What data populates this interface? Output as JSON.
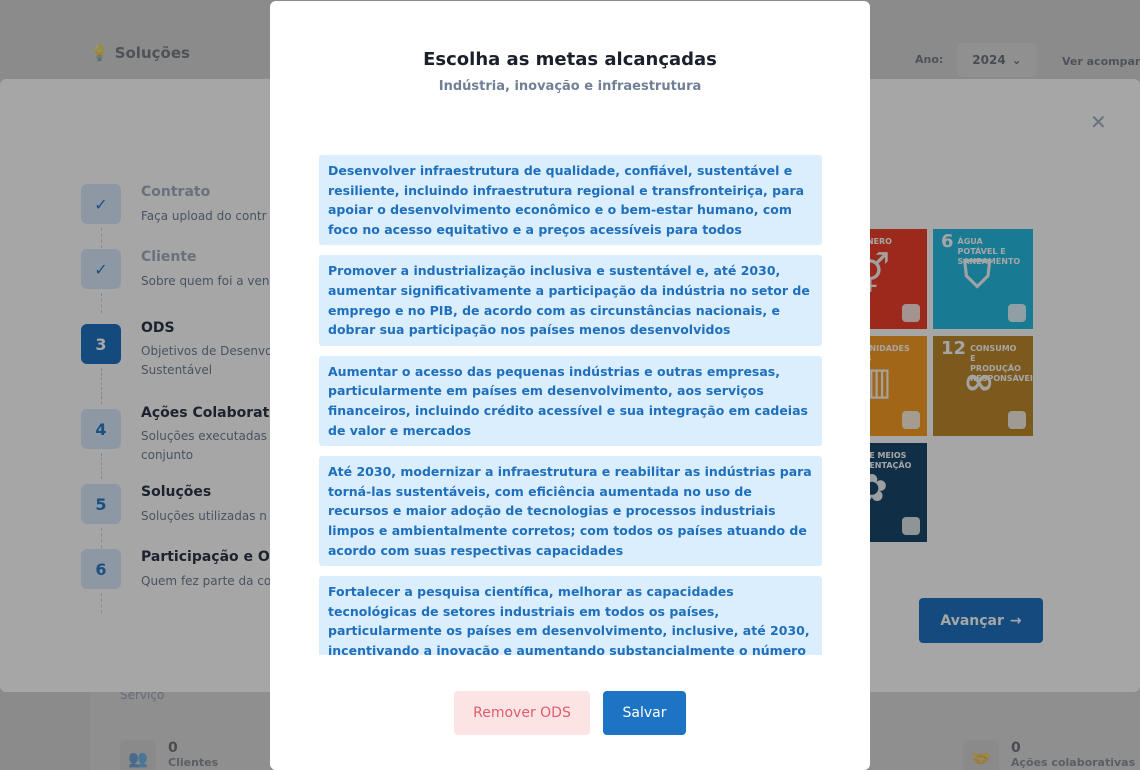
{
  "background": {
    "title": "Soluções",
    "year_label": "Ano:",
    "year_value": "2024",
    "ver_link": "Ver acompan",
    "servico_label": "Serviço",
    "stats": [
      {
        "value": "0",
        "label": "Clientes",
        "icon": "users-icon"
      },
      {
        "value": "0",
        "label": "Ações colaborativas",
        "icon": "handshake-icon"
      }
    ]
  },
  "wizard": {
    "steps": [
      {
        "badge": "✓",
        "title": "Contrato",
        "desc": "Faça upload do contr",
        "state": "done"
      },
      {
        "badge": "✓",
        "title": "Cliente",
        "desc": "Sobre quem foi a ven",
        "state": "done"
      },
      {
        "badge": "3",
        "title": "ODS",
        "desc": "Objetivos de Desenvo Sustentável",
        "state": "active"
      },
      {
        "badge": "4",
        "title": "Ações Colaborativ",
        "desc": "Soluções executadas conjunto",
        "state": "pending"
      },
      {
        "badge": "5",
        "title": "Soluções",
        "desc": "Soluções utilizadas n",
        "state": "pending"
      },
      {
        "badge": "6",
        "title": "Participação e Ori",
        "desc": "Quem fez parte da co",
        "state": "pending"
      }
    ],
    "ods_tiles": [
      {
        "num": "",
        "label": "LDADE NERO",
        "color": "#ef402c",
        "glyph": "⚥"
      },
      {
        "num": "6",
        "label": "ÁGUA POTÁVEL E SANEAMENTO",
        "color": "#27bde2",
        "glyph": "⛉"
      },
      {
        "num": "",
        "label": "DES E UNIDADES NTÁVEIS",
        "color": "#f99d26",
        "glyph": "▥"
      },
      {
        "num": "12",
        "label": "CONSUMO E PRODUÇÃO RESPONSÁVEIS",
        "color": "#bf8b2e",
        "glyph": "∞"
      },
      {
        "num": "",
        "label": "CERIAS E MEIOS IMPLEMENTAÇÃO",
        "color": "#19486a",
        "glyph": "✿"
      }
    ],
    "advance_label": "Avançar"
  },
  "dialog": {
    "title": "Escolha as metas alcançadas",
    "subtitle": "Indústria, inovação e infraestrutura",
    "goals": [
      "Desenvolver infraestrutura de qualidade, confiável, sustentável e resiliente, incluindo infraestrutura regional e transfronteiriça, para apoiar o desenvolvimento econômico e o bem-estar humano, com foco no acesso equitativo e a preços acessíveis para todos",
      "Promover a industrialização inclusiva e sustentável e, até 2030, aumentar significativamente a participação da indústria no setor de emprego e no PIB, de acordo com as circunstâncias nacionais, e dobrar sua participação nos países menos desenvolvidos",
      "Aumentar o acesso das pequenas indústrias e outras empresas, particularmente em países em desenvolvimento, aos serviços financeiros, incluindo crédito acessível e sua integração em cadeias de valor e mercados",
      "Até 2030, modernizar a infraestrutura e reabilitar as indústrias para torná-las sustentáveis, com eficiência aumentada no uso de recursos e maior adoção de tecnologias e processos industriais limpos e ambientalmente corretos; com todos os países atuando de acordo com suas respectivas capacidades",
      "Fortalecer a pesquisa científica, melhorar as capacidades tecnológicas de setores industriais em todos os países, particularmente os países em desenvolvimento, inclusive, até 2030, incentivando a inovação e aumentando substancialmente o número de trabalhadores de pesquisa e desenvolvimento por milhão de pessoas e os gastos público e privado em"
    ],
    "remove_label": "Remover ODS",
    "save_label": "Salvar"
  }
}
